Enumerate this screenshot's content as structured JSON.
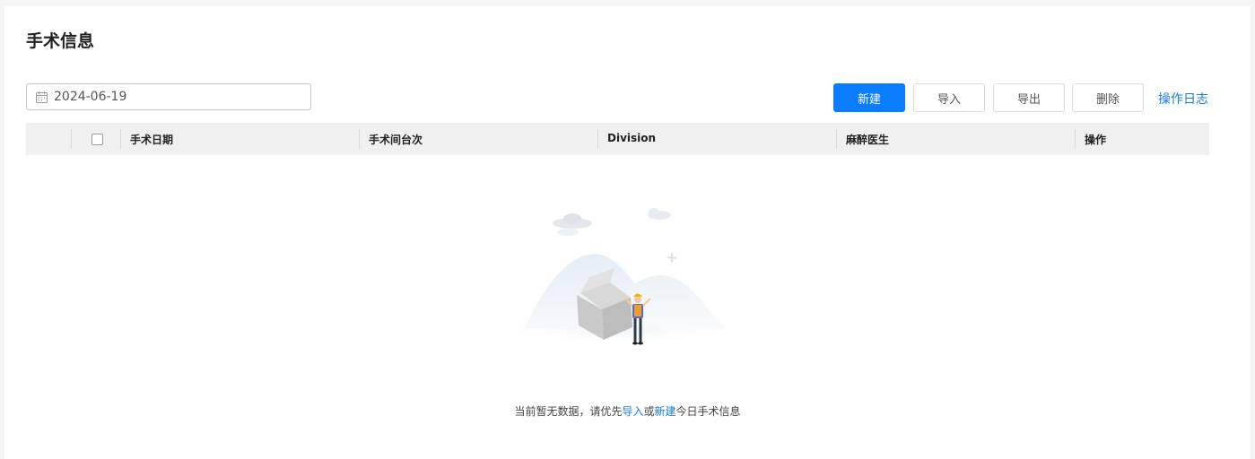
{
  "page": {
    "title": "手术信息"
  },
  "filter": {
    "date_value": "2024-06-19"
  },
  "toolbar": {
    "new_label": "新建",
    "import_label": "导入",
    "export_label": "导出",
    "delete_label": "删除",
    "log_label": "操作日志"
  },
  "table": {
    "columns": [
      "手术日期",
      "手术间台次",
      "Division",
      "麻醉医生",
      "操作"
    ]
  },
  "empty": {
    "text_before": "当前暂无数据，请优先",
    "import_link": "导入",
    "or_text": "或",
    "new_link": "新建",
    "text_after": "今日手术信息"
  },
  "colors": {
    "primary": "#0a7cff",
    "link": "#1a7ce0"
  }
}
